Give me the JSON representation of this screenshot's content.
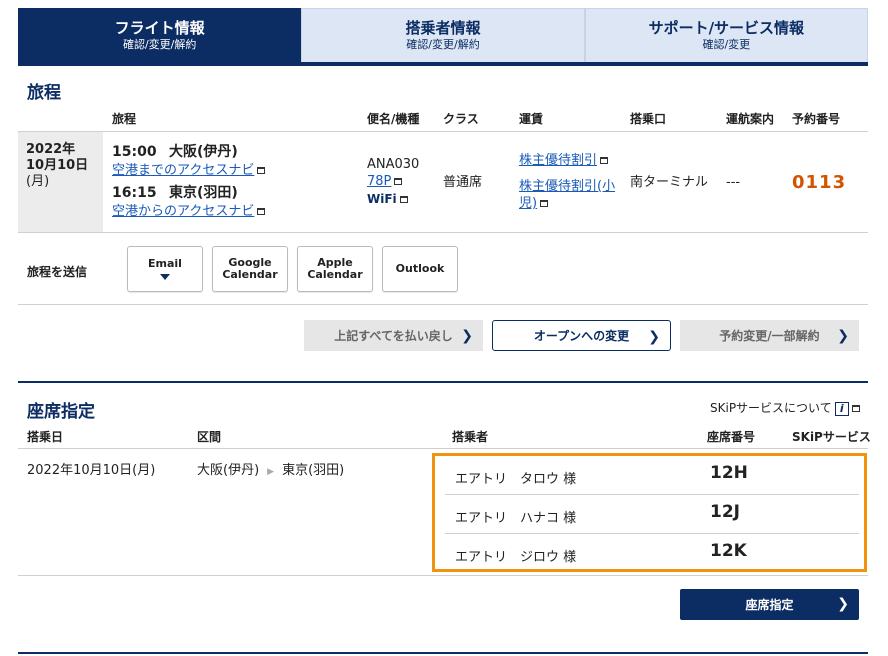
{
  "tabs": [
    {
      "title": "フライト情報",
      "sub": "確認/変更/解約"
    },
    {
      "title": "搭乗者情報",
      "sub": "確認/変更/解約"
    },
    {
      "title": "サポート/サービス情報",
      "sub": "確認/変更"
    }
  ],
  "itinerary": {
    "title": "旅程",
    "headers": {
      "route": "旅程",
      "flight": "便名/機種",
      "class": "クラス",
      "fare": "運賃",
      "gate": "搭乗口",
      "status": "運航案内",
      "reservation": "予約番号"
    },
    "date_year": "2022年",
    "date_md": "10月10日",
    "date_dow": "(月)",
    "dep_time": "15:00",
    "dep_place": "大阪(伊丹)",
    "dep_link": "空港までのアクセスナビ",
    "arr_time": "16:15",
    "arr_place": "東京(羽田)",
    "arr_link": "空港からのアクセスナビ",
    "flight_no": "ANA030",
    "aircraft": "78P",
    "wifi": "WiFi",
    "class": "普通席",
    "fare1": "株主優待割引",
    "fare2": "株主優待割引(小児)",
    "gate": "南ターミナル",
    "status": "---",
    "reservation_no": "0113"
  },
  "share": {
    "label": "旅程を送信",
    "email": "Email",
    "google_l1": "Google",
    "google_l2": "Calendar",
    "apple_l1": "Apple",
    "apple_l2": "Calendar",
    "outlook": "Outlook"
  },
  "actions": {
    "refund_all": "上記すべてを払い戻し",
    "change_open": "オープンへの変更",
    "partial_cancel": "予約変更/一部解約"
  },
  "seats": {
    "title": "座席指定",
    "skip_about": "SKiPサービスについて",
    "info_icon": "i",
    "headers": {
      "date": "搭乗日",
      "segment": "区間",
      "passenger": "搭乗者",
      "seat": "座席番号",
      "skip": "SKiPサービス"
    },
    "date": "2022年10月10日(月)",
    "from": "大阪(伊丹)",
    "to": "東京(羽田)",
    "passengers": [
      {
        "name": "エアトリ　タロウ 様",
        "seat": "12H"
      },
      {
        "name": "エアトリ　ハナコ 様",
        "seat": "12J"
      },
      {
        "name": "エアトリ　ジロウ 様",
        "seat": "12K"
      }
    ],
    "button": "座席指定"
  },
  "colors": {
    "navy": "#0c2d63",
    "highlight": "#f0930d",
    "reservation": "#d35400",
    "link": "#1a5bb8"
  }
}
